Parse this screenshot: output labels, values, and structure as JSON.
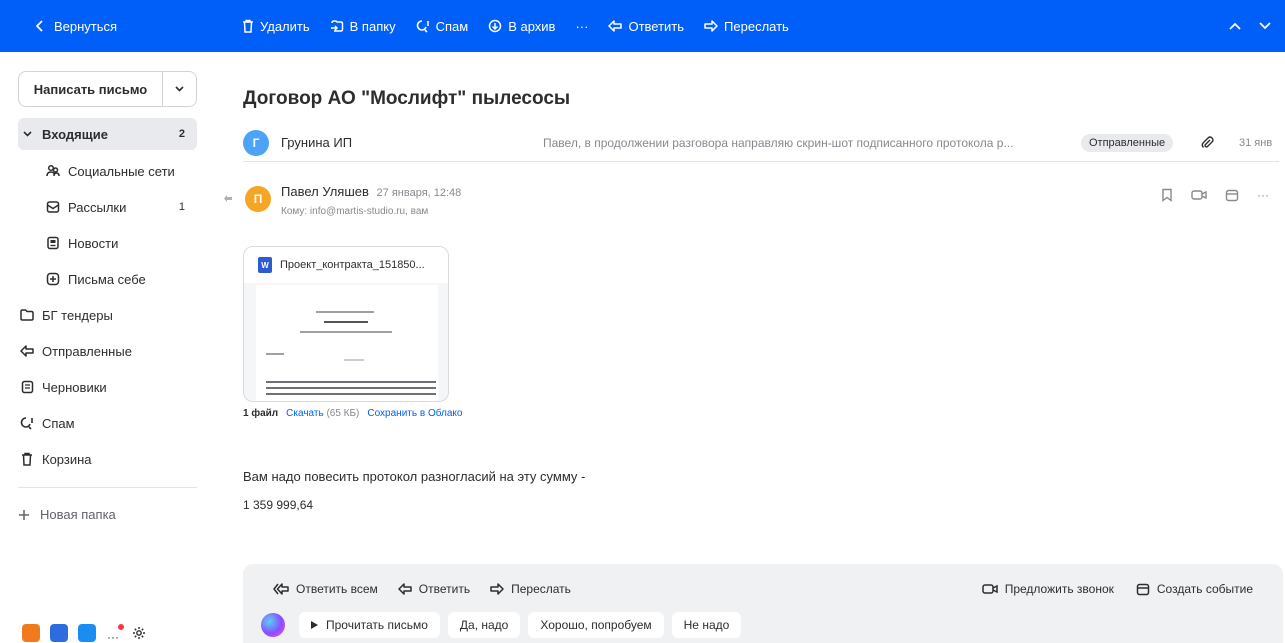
{
  "toolbar": {
    "back": "Вернуться",
    "delete": "Удалить",
    "to_folder": "В папку",
    "spam": "Спам",
    "archive": "В архив",
    "more": "···",
    "reply": "Ответить",
    "forward": "Переслать"
  },
  "sidebar": {
    "compose": "Написать письмо",
    "inbox": {
      "label": "Входящие",
      "count": "2"
    },
    "social": {
      "label": "Социальные сети"
    },
    "newsletters": {
      "label": "Рассылки",
      "count": "1"
    },
    "news": {
      "label": "Новости"
    },
    "self": {
      "label": "Письма себе"
    },
    "tenders": {
      "label": "БГ тендеры"
    },
    "sent": {
      "label": "Отправленные"
    },
    "drafts": {
      "label": "Черновики"
    },
    "spam": {
      "label": "Спам"
    },
    "trash": {
      "label": "Корзина"
    },
    "new_folder": "Новая папка"
  },
  "message": {
    "subject": "Договор АО \"Мослифт\" пылесосы",
    "thread": {
      "avatar_letter": "Г",
      "name": "Грунина ИП",
      "snippet": "Павел, в продолжении разговора направляю скрин-шот подписанного протокола р...",
      "folder_badge": "Отправленные",
      "date": "31 янв"
    },
    "sender": {
      "avatar_letter": "П",
      "name": "Павел Уляшев",
      "date": "27 января, 12:48",
      "to_line": "Кому: info@martis-studio.ru,  вам"
    },
    "attachment": {
      "filename": "Проект_контракта_151850...",
      "file_icon_letter": "W",
      "files_count": "1 файл",
      "download": "Скачать",
      "size": "(65 КБ)",
      "save_cloud": "Сохранить в Облако"
    },
    "body": {
      "line1": "Вам надо повесить протокол разногласий на эту сумму -",
      "line2": "1 359 999,64"
    }
  },
  "reply_panel": {
    "reply_all": "Ответить всем",
    "reply": "Ответить",
    "forward": "Переслать",
    "call": "Предложить звонок",
    "event": "Создать событие",
    "chips": {
      "read": "Прочитать письмо",
      "yes": "Да, надо",
      "ok": "Хорошо, попробуем",
      "no": "Не надо"
    }
  },
  "colors": {
    "accent": "#005ff9",
    "thread_avatar": "#4da3f7",
    "sender_avatar": "#f5a623"
  }
}
